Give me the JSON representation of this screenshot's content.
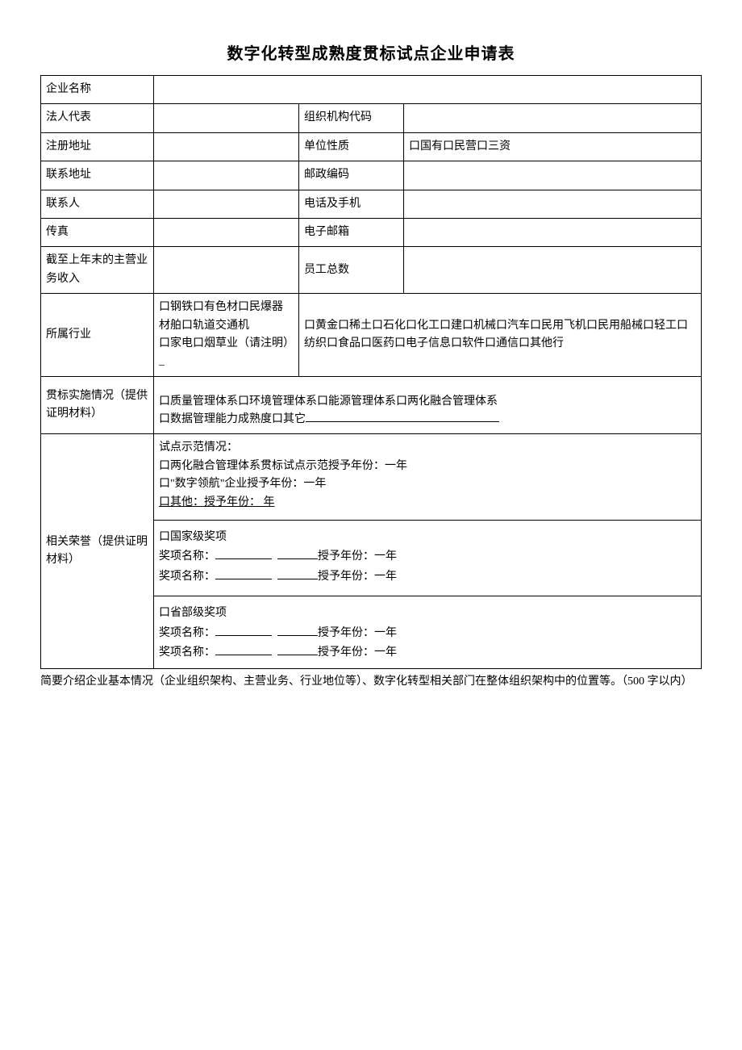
{
  "title": "数字化转型成熟度贯标试点企业申请表",
  "labels": {
    "company_name": "企业名称",
    "legal_rep": "法人代表",
    "org_code": "组织机构代码",
    "reg_addr": "注册地址",
    "unit_type": "单位性质",
    "unit_type_opts": "口国有口民营口三资",
    "contact_addr": "联系地址",
    "postal": "邮政编码",
    "contact": "联系人",
    "phone": "电话及手机",
    "fax": "传真",
    "email": "电子邮箱",
    "prev_revenue": "截至上年末的主营业务收入",
    "emp_count": "员工总数",
    "industry": "所属行业",
    "industry_col1": "口钢铁口有色材口民爆器材舶口轨道交通机\n口家电口烟草业（请注明）_",
    "industry_col2": "口黄金口稀土口石化口化工口建口机械口汽车口民用飞机口民用船械口轻工口纺织口食品口医药口电子信息口软件口通信口其他行",
    "impl_label": "贯标实施情况（提供证明材料）",
    "impl_opts_line1": "口质量管理体系口环境管理体系口能源管理体系口两化融合管理体系",
    "impl_opts_line2_prefix": "口数据管理能力成熟度口其它",
    "honors_label": "相关荣誉（提供证明材料）",
    "pilot_header": "试点示范情况：",
    "pilot_line1": "口两化融合管理体系贯标试点示范授予年份：一年",
    "pilot_line2": "口\"数字领航\"企业授予年份：一年",
    "pilot_line3": "口其他：授予年份： 年",
    "award_nat": "口国家级奖项",
    "award_name_prefix": "奖项名称：",
    "award_year_prefix": "授予年份：一年",
    "award_prov": "口省部级奖项"
  },
  "footer": "简要介绍企业基本情况（企业组织架构、主营业务、行业地位等）、数字化转型相关部门在整体组织架构中的位置等。（500 字以内）"
}
